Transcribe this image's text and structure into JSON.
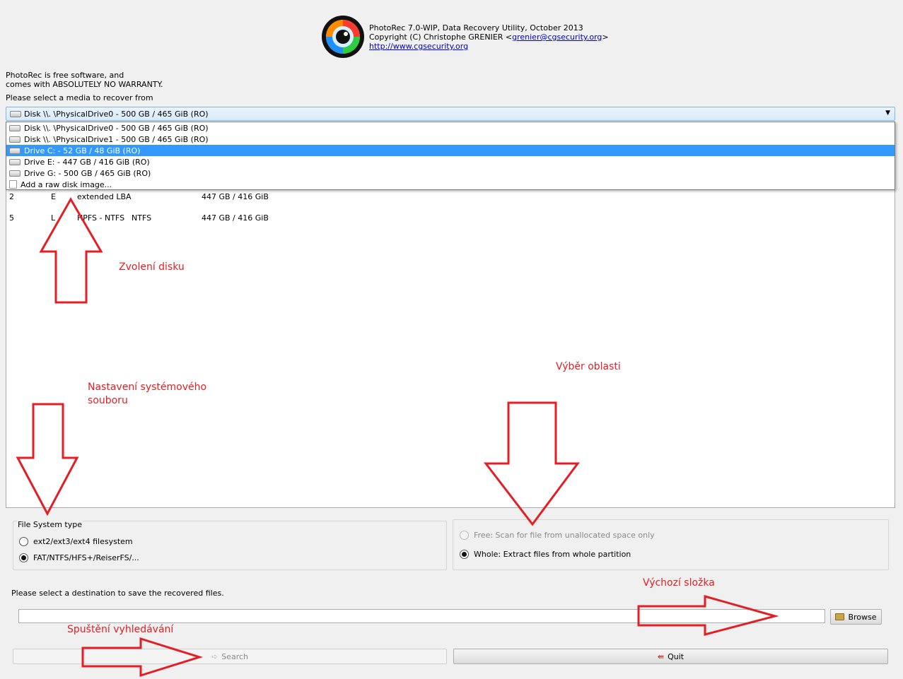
{
  "about": {
    "line1": "PhotoRec 7.0-WIP, Data Recovery Utility, October 2013",
    "line2_prefix": "Copyright (C) Christophe GRENIER <",
    "email": "grenier@cgsecurity.org",
    "line2_suffix": ">",
    "website": "http://www.cgsecurity.org"
  },
  "license": {
    "line1": "PhotoRec is free software, and",
    "line2": "comes with ABSOLUTELY NO WARRANTY."
  },
  "media": {
    "label": "Please select a media to recover from",
    "selected": "Disk \\\\. \\PhysicalDrive0 - 500 GB / 465 GiB (RO)",
    "options": [
      {
        "label": "Disk \\\\. \\PhysicalDrive0 - 500 GB / 465 GiB (RO)",
        "icon": "disk-icon"
      },
      {
        "label": "Disk \\\\. \\PhysicalDrive1 - 500 GB / 465 GiB (RO)",
        "icon": "disk-icon"
      },
      {
        "label": "Drive C: - 52 GB / 48 GiB (RO)",
        "icon": "disk-icon"
      },
      {
        "label": "Drive E: - 447 GB / 416 GiB (RO)",
        "icon": "disk-icon"
      },
      {
        "label": "Drive G: - 500 GB / 465 GiB (RO)",
        "icon": "disk-icon"
      },
      {
        "label": "Add a raw disk image...",
        "icon": "image-file-icon"
      }
    ],
    "highlighted_index": 2
  },
  "partitions": [
    {
      "num": "2",
      "flag": "E",
      "type": "extended LBA",
      "fs": "",
      "size": "447 GB / 416 GiB"
    },
    {
      "num": "5",
      "flag": "L",
      "type": "HPFS - NTFS",
      "fs": "NTFS",
      "size": "447 GB / 416 GiB"
    }
  ],
  "fs_type": {
    "title": "File System type",
    "opt1": "ext2/ext3/ext4 filesystem",
    "opt2": "FAT/NTFS/HFS+/ReiserFS/..."
  },
  "scan": {
    "free": "Free: Scan for file from unallocated space only",
    "whole": "Whole: Extract files from whole partition"
  },
  "destination": {
    "label": "Please select a destination to save the recovered files.",
    "value": ""
  },
  "buttons": {
    "browse": "Browse",
    "search": "Search",
    "quit": "Quit"
  },
  "annotations": {
    "disk": "Zvolení disku",
    "area": "Výběr oblasti",
    "fs_line1": "Nastavení systémového",
    "fs_line2": "souboru",
    "folder": "Výchozí složka",
    "search": "Spuštění vyhledávání"
  },
  "colors": {
    "annotation": "#e31e24",
    "highlight": "#3399ff"
  }
}
